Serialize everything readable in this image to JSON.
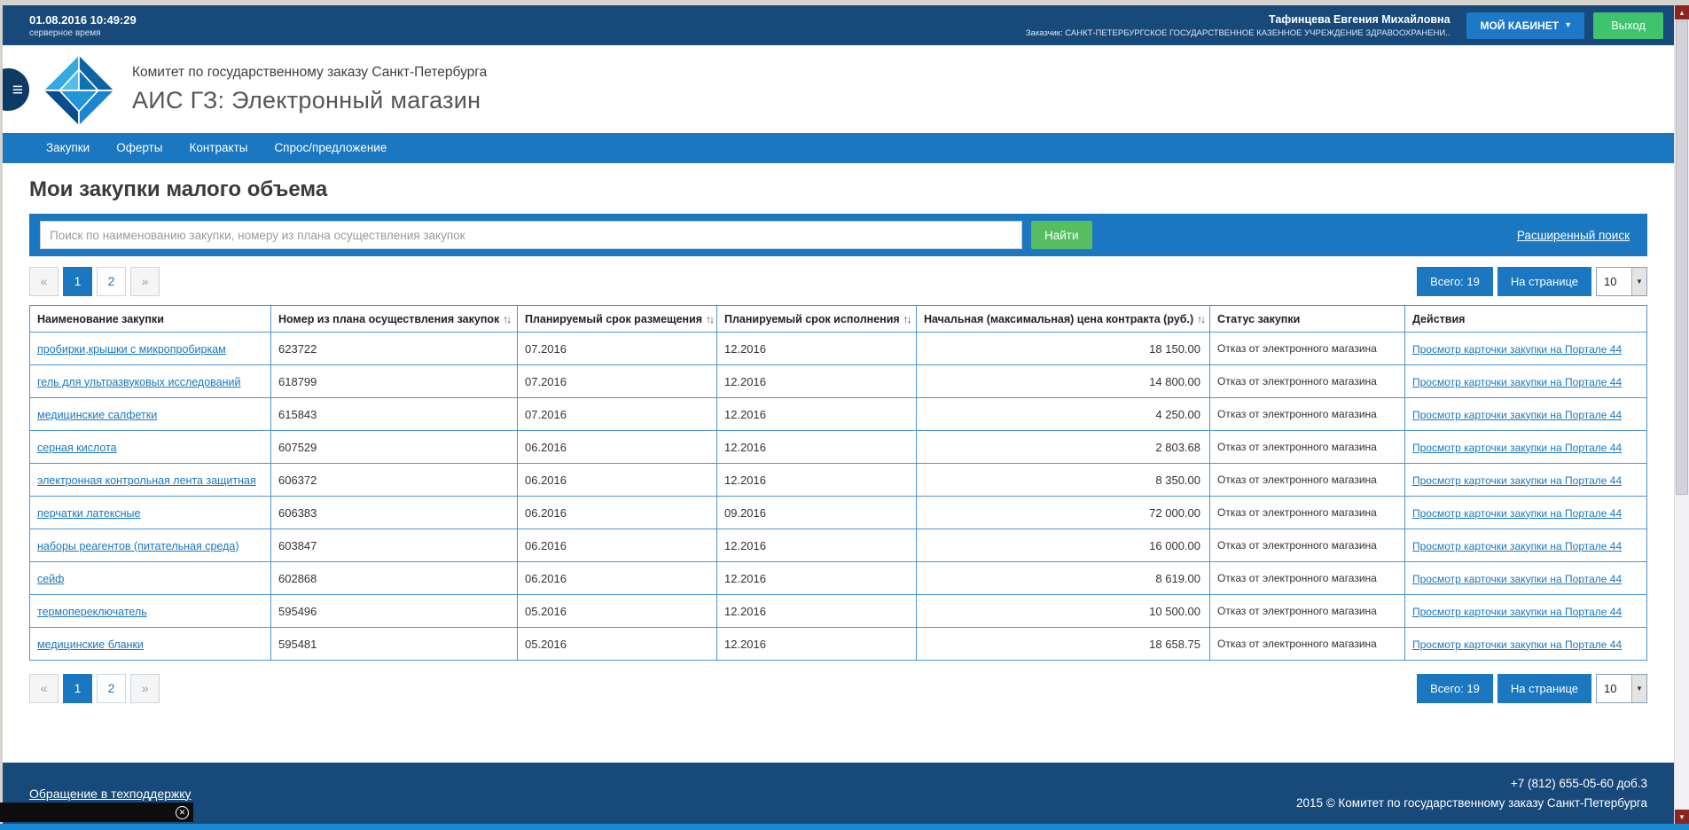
{
  "topbar": {
    "datetime": "01.08.2016 10:49:29",
    "server_time_label": "серверное время",
    "user_name": "Тафинцева Евгения Михайловна",
    "customer_label": "Заказчик: САНКТ-ПЕТЕРБУРГСКОЕ ГОСУДАРСТВЕННОЕ КАЗЕННОЕ УЧРЕЖДЕНИЕ ЗДРАВООХРАНЕНИ..",
    "cabinet_button": "МОЙ КАБИНЕТ",
    "logout_button": "Выход"
  },
  "header": {
    "org_line": "Комитет по государственному заказу Санкт-Петербурга",
    "app_title": "АИС ГЗ: Электронный магазин"
  },
  "nav": {
    "items": [
      {
        "label": "Закупки"
      },
      {
        "label": "Оферты"
      },
      {
        "label": "Контракты"
      },
      {
        "label": "Спрос/предложение"
      }
    ]
  },
  "page": {
    "title": "Мои закупки малого объема"
  },
  "search": {
    "placeholder": "Поиск по наименованию закупки, номеру из плана осуществления закупок",
    "button": "Найти",
    "advanced_link": "Расширенный поиск"
  },
  "pagination": {
    "prev_label": "«",
    "next_label": "»",
    "pages": [
      "1",
      "2"
    ],
    "active_page": "1",
    "total_label": "Всего: 19",
    "per_page_label": "На странице",
    "per_page_value": "10"
  },
  "table": {
    "columns": [
      {
        "label": "Наименование закупки",
        "sortable": false
      },
      {
        "label": "Номер из плана осуществления закупок",
        "sortable": true
      },
      {
        "label": "Планируемый срок размещения",
        "sortable": true
      },
      {
        "label": "Планируемый срок исполнения",
        "sortable": true
      },
      {
        "label": "Начальная (максимальная) цена контракта (руб.)",
        "sortable": true
      },
      {
        "label": "Статус закупки",
        "sortable": false
      },
      {
        "label": "Действия",
        "sortable": false
      }
    ],
    "status": "Отказ от электронного магазина",
    "action_link": "Просмотр карточки закупки на Портале 44",
    "rows": [
      {
        "name": "пробирки,крышки с микропробиркам",
        "number": "623722",
        "placement": "07.2016",
        "execution": "12.2016",
        "price": "18 150.00"
      },
      {
        "name": "гель для ультразвуковых исследований",
        "number": "618799",
        "placement": "07.2016",
        "execution": "12.2016",
        "price": "14 800.00"
      },
      {
        "name": "медицинские салфетки",
        "number": "615843",
        "placement": "07.2016",
        "execution": "12.2016",
        "price": "4 250.00"
      },
      {
        "name": "серная кислота",
        "number": "607529",
        "placement": "06.2016",
        "execution": "12.2016",
        "price": "2 803.68"
      },
      {
        "name": "электронная контрольная лента защитная",
        "number": "606372",
        "placement": "06.2016",
        "execution": "12.2016",
        "price": "8 350.00"
      },
      {
        "name": "перчатки латексные",
        "number": "606383",
        "placement": "06.2016",
        "execution": "09.2016",
        "price": "72 000.00"
      },
      {
        "name": "наборы реагентов (питательная среда)",
        "number": "603847",
        "placement": "06.2016",
        "execution": "12.2016",
        "price": "16 000.00"
      },
      {
        "name": "сейф",
        "number": "602868",
        "placement": "06.2016",
        "execution": "12.2016",
        "price": "8 619.00"
      },
      {
        "name": "термопереключатель",
        "number": "595496",
        "placement": "05.2016",
        "execution": "12.2016",
        "price": "10 500.00"
      },
      {
        "name": "медицинские бланки",
        "number": "595481",
        "placement": "05.2016",
        "execution": "12.2016",
        "price": "18 658.75"
      }
    ]
  },
  "footer": {
    "support_link": "Обращение в техподдержку",
    "phone": "+7 (812) 655-05-60 доб.3",
    "copyright": "2015 © Комитет по государственному заказу Санкт-Петербурга"
  },
  "icons": {
    "menu": "≡",
    "caret_down": "▾",
    "sort": "↑↓",
    "select_arrow": "▼",
    "scroll_up": "▲",
    "scroll_down": "▼",
    "close": "✕"
  },
  "colors": {
    "dark_blue": "#17497b",
    "mid_blue": "#1a77c0",
    "button_blue": "#1d79c7",
    "green": "#3ec46d",
    "green_search": "#57bd61",
    "table_border": "#4e96d2",
    "link_blue": "#1a77c0",
    "taskbar_blue": "#1989d2"
  }
}
